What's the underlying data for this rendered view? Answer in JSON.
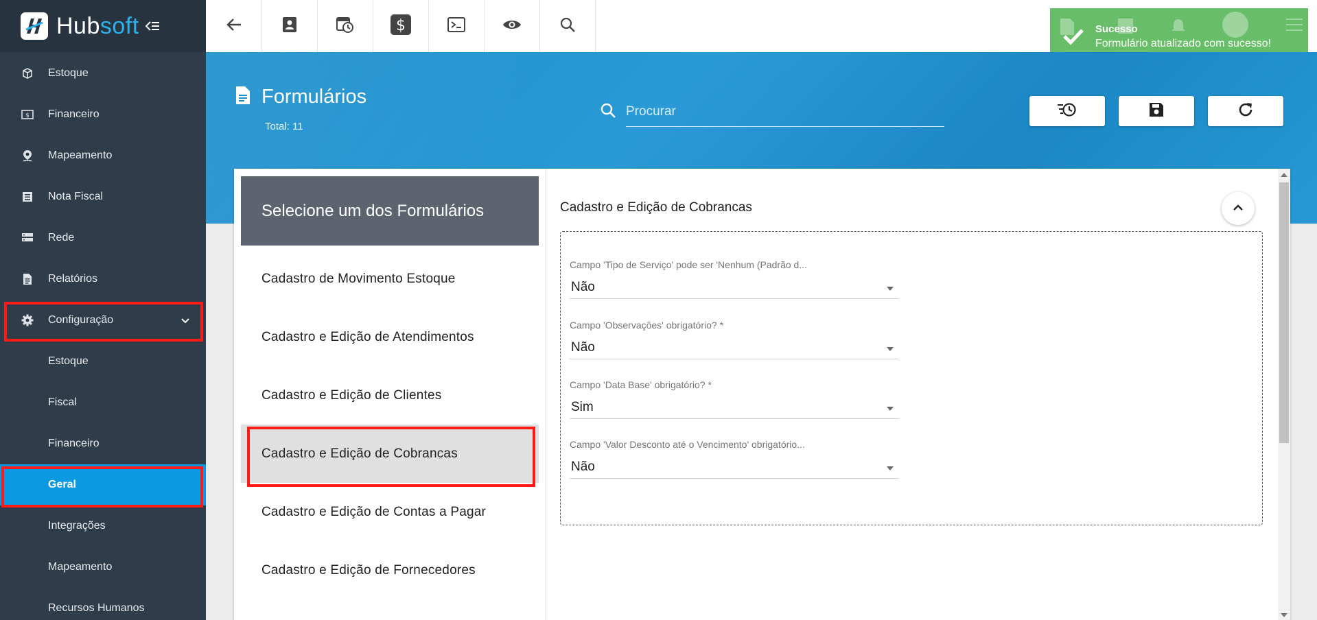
{
  "brand": {
    "name_part1": "Hub",
    "name_part2": "soft"
  },
  "sidebar": {
    "items": [
      {
        "label": "Estoque",
        "icon": "cube-icon"
      },
      {
        "label": "Financeiro",
        "icon": "cash-icon"
      },
      {
        "label": "Mapeamento",
        "icon": "map-pin-icon"
      },
      {
        "label": "Nota Fiscal",
        "icon": "list-doc-icon"
      },
      {
        "label": "Rede",
        "icon": "server-icon"
      },
      {
        "label": "Relatórios",
        "icon": "document-icon"
      },
      {
        "label": "Configuração",
        "icon": "gear-icon"
      }
    ],
    "sub_items": [
      {
        "label": "Estoque"
      },
      {
        "label": "Fiscal"
      },
      {
        "label": "Financeiro"
      },
      {
        "label": "Geral"
      },
      {
        "label": "Integrações"
      },
      {
        "label": "Mapeamento"
      },
      {
        "label": "Recursos Humanos"
      }
    ]
  },
  "topbar": {
    "icons": [
      "back-arrow-icon",
      "contact-card-icon",
      "calendar-clock-icon",
      "dollar-icon",
      "terminal-icon",
      "eye-icon",
      "search-icon"
    ]
  },
  "toast": {
    "title": "Sucesso",
    "message": "Formulário atualizado com sucesso!",
    "color": "#5cb85c"
  },
  "page": {
    "title": "Formulários",
    "total": "Total: 11",
    "search_placeholder": "Procurar"
  },
  "form_list": {
    "header": "Selecione um dos Formulários",
    "items": [
      "Cadastro de Movimento Estoque",
      "Cadastro e Edição de Atendimentos",
      "Cadastro e Edição de Clientes",
      "Cadastro e Edição de Cobrancas",
      "Cadastro e Edição de Contas a Pagar",
      "Cadastro e Edição de Fornecedores"
    ],
    "selected": "Cadastro e Edição de Cobrancas"
  },
  "detail": {
    "title": "Cadastro e Edição de Cobrancas",
    "fields": [
      {
        "label": "Campo 'Tipo de Serviço' pode ser 'Nenhum (Padrão d...",
        "value": "Não"
      },
      {
        "label": "Campo 'Observações' obrigatório? *",
        "value": "Não"
      },
      {
        "label": "Campo 'Data Base' obrigatório? *",
        "value": "Sim"
      },
      {
        "label": "Campo 'Valor Desconto até o Vencimento' obrigatório...",
        "value": "Não"
      }
    ]
  },
  "colors": {
    "sidebar_bg": "#2f3d4a",
    "active_item": "#0b9ae2",
    "banner": "#1d8fcc",
    "highlight": "#ff1a1a"
  }
}
